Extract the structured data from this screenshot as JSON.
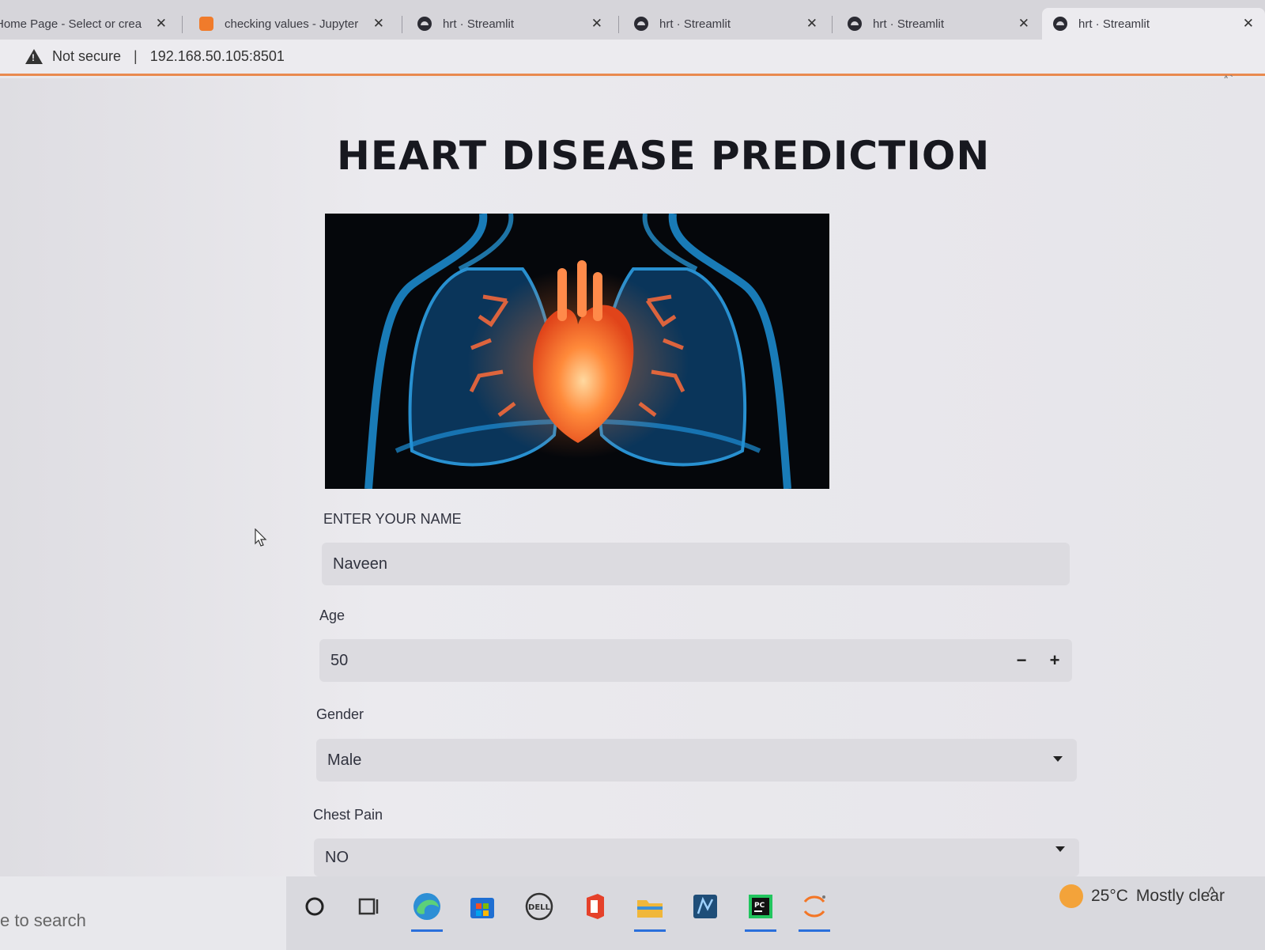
{
  "browser": {
    "tabs": [
      {
        "title": "Home Page - Select or crea",
        "icon": "jupyter-icon"
      },
      {
        "title": "checking values - Jupyter N",
        "icon": "jupyter-icon"
      },
      {
        "title": "hrt · Streamlit",
        "icon": "streamlit-icon"
      },
      {
        "title": "hrt · Streamlit",
        "icon": "streamlit-icon"
      },
      {
        "title": "hrt · Streamlit",
        "icon": "streamlit-icon"
      },
      {
        "title": "hrt · Streamlit",
        "icon": "streamlit-icon"
      }
    ],
    "security": "Not secure",
    "url": "192.168.50.105:8501",
    "read_aloud": "A`"
  },
  "app": {
    "title": "HEART DISEASE PREDICTION",
    "image_icon": "heart-lungs-xray-illustration",
    "name_field": {
      "label": "ENTER YOUR NAME",
      "value": "Naveen"
    },
    "age_field": {
      "label": "Age",
      "value": "50",
      "minus": "−",
      "plus": "+"
    },
    "gender_field": {
      "label": "Gender",
      "value": "Male"
    },
    "chest_pain_field": {
      "label": "Chest Pain",
      "value": "NO"
    }
  },
  "taskbar": {
    "search_text": "e to search",
    "icons": [
      "cortana-icon",
      "task-view-icon",
      "edge-icon",
      "store-icon",
      "dell-icon",
      "office-icon",
      "file-explorer-icon",
      "anaconda-navigator-icon",
      "pycharm-icon",
      "jupyter-icon"
    ],
    "weather": {
      "temp": "25°C",
      "condition": "Mostly clear"
    },
    "chevron": "^"
  },
  "colors": {
    "accent_line": "#e98a4f",
    "field_bg": "#dcdbe0",
    "taskbar_highlight": "#2a6fdb"
  }
}
